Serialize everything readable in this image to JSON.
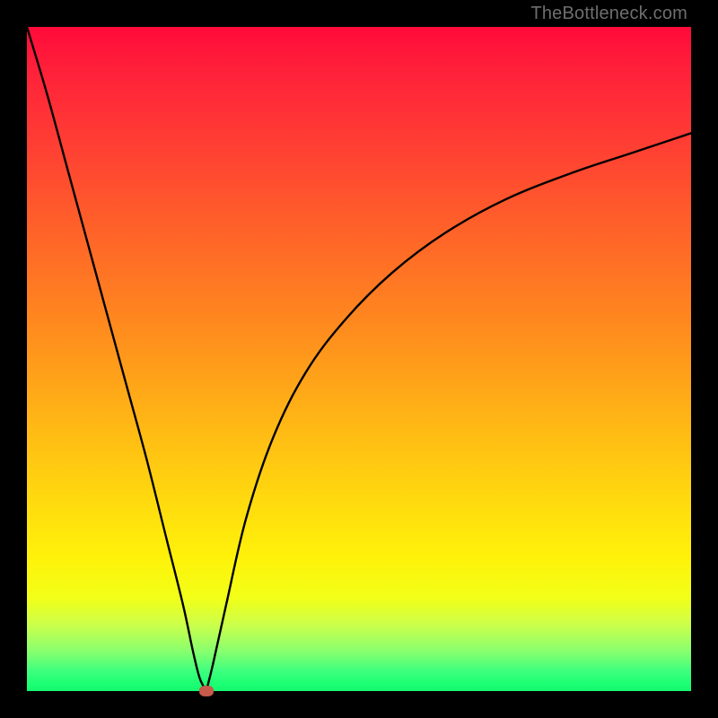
{
  "watermark": "TheBottleneck.com",
  "colors": {
    "frame": "#000000",
    "curve": "#000000",
    "dot": "#c85a4b"
  },
  "chart_data": {
    "type": "line",
    "title": "",
    "xlabel": "",
    "ylabel": "",
    "xlim": [
      0,
      100
    ],
    "ylim": [
      0,
      100
    ],
    "grid": false,
    "marker": {
      "x": 27,
      "y": 0,
      "label": "bottleneck-minimum"
    },
    "series": [
      {
        "name": "left-branch",
        "x": [
          0,
          3,
          6,
          9,
          12,
          15,
          18,
          21,
          23.5,
          25,
          26,
          27
        ],
        "y": [
          100,
          90,
          79,
          68,
          57,
          46,
          35,
          23,
          13,
          6,
          2,
          0
        ]
      },
      {
        "name": "right-branch",
        "x": [
          27,
          28,
          30,
          33,
          37,
          42,
          48,
          55,
          63,
          72,
          82,
          91,
          100
        ],
        "y": [
          0,
          4,
          13,
          26,
          38,
          48,
          56,
          63,
          69,
          74,
          78,
          81,
          84
        ]
      }
    ]
  }
}
